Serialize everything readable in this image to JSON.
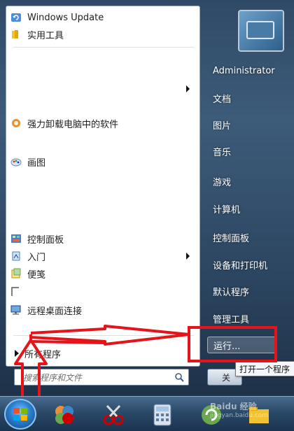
{
  "start_menu": {
    "pinned_programs": [
      {
        "label": "Windows Update",
        "icon": "windows-update-icon"
      },
      {
        "label": "实用工具",
        "icon": "folder-icon"
      }
    ],
    "recent_programs": [
      {
        "label": "强力卸载电脑中的软件",
        "icon": "uninstall-icon"
      },
      {
        "label": "画图",
        "icon": "paint-icon"
      },
      {
        "label": "控制面板",
        "icon": "control-panel-icon"
      },
      {
        "label": "入门",
        "icon": "getting-started-icon"
      },
      {
        "label": "便笺",
        "icon": "sticky-notes-icon"
      },
      {
        "label": "远程桌面连接",
        "icon": "remote-desktop-icon"
      }
    ],
    "all_programs_label": "所有程序",
    "search_placeholder": "搜索程序和文件",
    "right_links": [
      {
        "label": "Administrator"
      },
      {
        "label": "文档"
      },
      {
        "label": "图片"
      },
      {
        "label": "音乐"
      },
      {
        "label": "游戏"
      },
      {
        "label": "计算机"
      },
      {
        "label": "控制面板"
      },
      {
        "label": "设备和打印机"
      },
      {
        "label": "默认程序"
      },
      {
        "label": "管理工具"
      }
    ],
    "run_label": "运行...",
    "shutdown_label": "关",
    "tooltip": "打开一个程序"
  },
  "watermark": {
    "brand": "Baidu 经验",
    "url": "jingyan.baidu.com"
  },
  "colors": {
    "annotation_red": "#e5141a",
    "accent_blue": "#2b7fd0"
  }
}
